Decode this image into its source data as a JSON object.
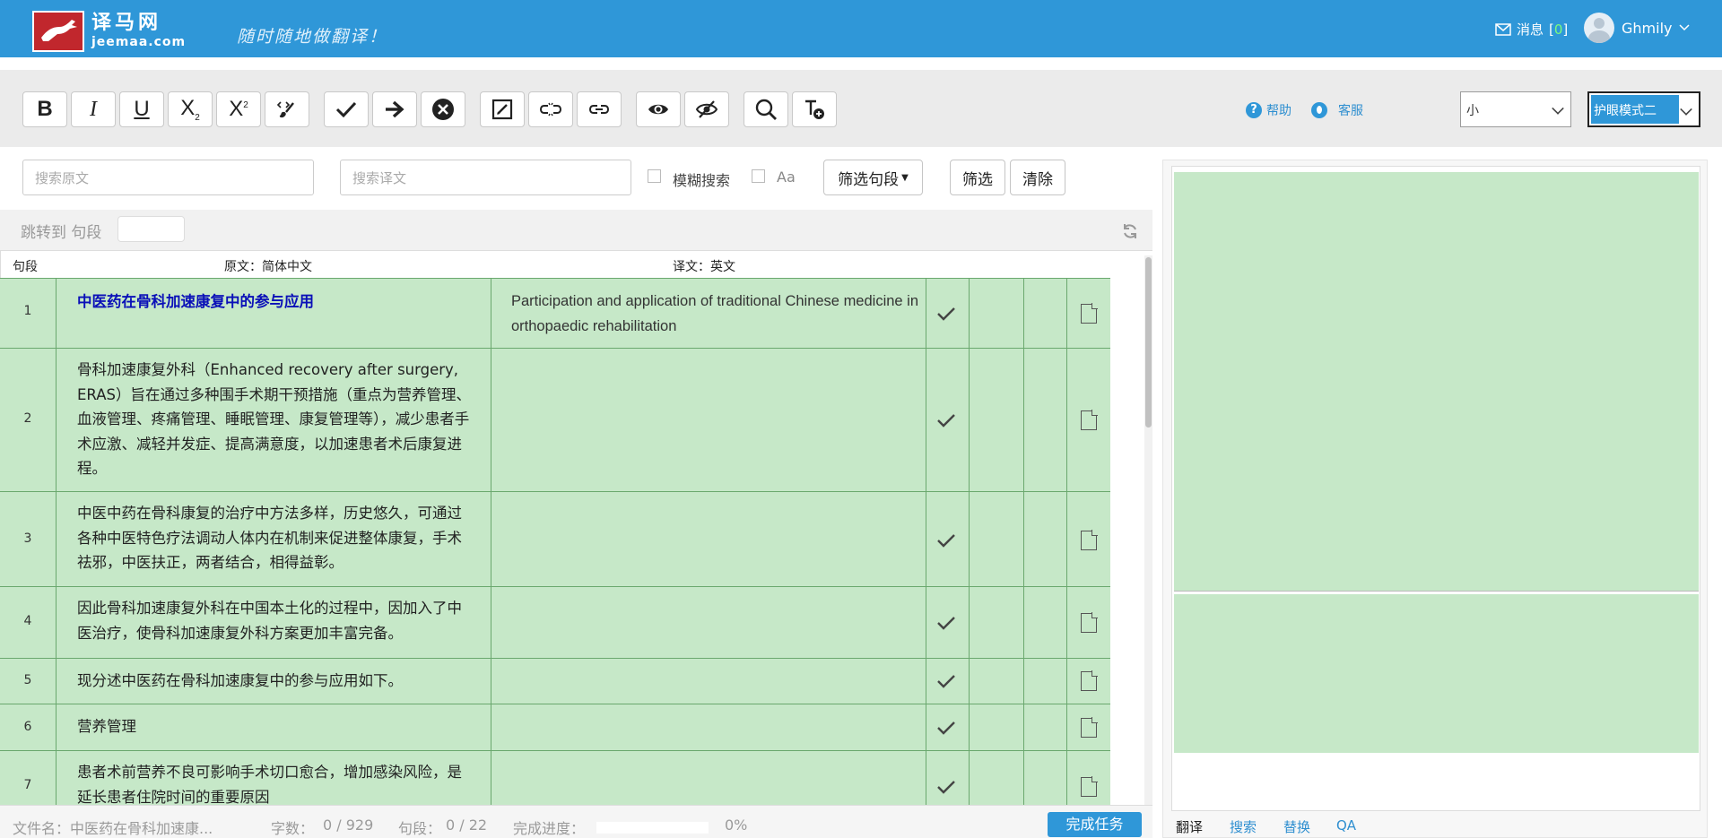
{
  "header": {
    "logo_cn": "译马网",
    "logo_en": "jeemaa.com",
    "slogan": "随时随地做翻译！",
    "messages_label": "消息",
    "messages_count": "0",
    "username": "Ghmily",
    "bg_color": "#2f97d8"
  },
  "toolbar": {
    "buttons": [
      {
        "name": "bold-button",
        "icon": "bold-icon",
        "glyph": "B"
      },
      {
        "name": "italic-button",
        "icon": "italic-icon",
        "glyph": "I"
      },
      {
        "name": "underline-button",
        "icon": "underline-icon",
        "glyph": "U"
      },
      {
        "name": "subscript-button",
        "icon": "subscript-icon",
        "glyph": "X₂"
      },
      {
        "name": "superscript-button",
        "icon": "superscript-icon",
        "glyph": "X²"
      },
      {
        "name": "clear-format-button",
        "icon": "brush-icon"
      },
      {
        "name": "confirm-button",
        "icon": "check-icon"
      },
      {
        "name": "next-button",
        "icon": "arrow-right-icon"
      },
      {
        "name": "cancel-button",
        "icon": "close-circle-icon"
      },
      {
        "name": "edit-button",
        "icon": "edit-box-icon"
      },
      {
        "name": "unlink-button",
        "icon": "unlink-icon"
      },
      {
        "name": "link-button",
        "icon": "link-icon"
      },
      {
        "name": "show-button",
        "icon": "eye-icon"
      },
      {
        "name": "hide-button",
        "icon": "eye-slash-icon"
      },
      {
        "name": "search-button",
        "icon": "search-icon"
      },
      {
        "name": "add-term-button",
        "icon": "text-add-icon"
      }
    ],
    "help_label": "帮助",
    "service_label": "客服",
    "font_size_value": "小",
    "mode_value": "护眼模式二"
  },
  "search": {
    "source_placeholder": "搜索原文",
    "target_placeholder": "搜索译文",
    "fuzzy_label": "模糊搜索",
    "case_label": "Aa",
    "filter_dropdown_label": "筛选句段",
    "filter_button": "筛选",
    "clear_button": "清除"
  },
  "jump": {
    "label": "跳转到 句段"
  },
  "columns": {
    "segment": "句段",
    "source": "原文：简体中文",
    "target": "译文：英文"
  },
  "segments": [
    {
      "num": "1",
      "source": "中医药在骨科加速康复中的参与应用",
      "target": "Participation and application of traditional Chinese medicine in orthopaedic rehabilitation"
    },
    {
      "num": "2",
      "source": "骨科加速康复外科（Enhanced recovery after surgery, ERAS）旨在通过多种围手术期干预措施（重点为营养管理、血液管理、疼痛管理、睡眠管理、康复管理等），减少患者手术应激、减轻并发症、提高满意度，以加速患者术后康复进程。",
      "target": ""
    },
    {
      "num": "3",
      "source": "中医中药在骨科康复的治疗中方法多样，历史悠久，可通过各种中医特色疗法调动人体内在机制来促进整体康复，手术祛邪，中医扶正，两者结合，相得益彰。",
      "target": ""
    },
    {
      "num": "4",
      "source": "因此骨科加速康复外科在中国本土化的过程中，因加入了中医治疗，使骨科加速康复外科方案更加丰富完备。",
      "target": ""
    },
    {
      "num": "5",
      "source": "现分述中医药在骨科加速康复中的参与应用如下。",
      "target": ""
    },
    {
      "num": "6",
      "source": "营养管理",
      "target": ""
    },
    {
      "num": "7",
      "source": "患者术前营养不良可影响手术切口愈合，增加感染风险，是延长患者住院时间的重要原因",
      "target": ""
    }
  ],
  "status": {
    "file_label": "文件名：中医药在骨科加速康...",
    "words_label": "字数：",
    "words_value": "0 / 929",
    "segments_label": "句段：",
    "segments_value": "0 / 22",
    "progress_label": "完成进度：",
    "progress_value": "0%",
    "progress_fraction": 0,
    "finish_button": "完成任务"
  },
  "right_panel": {
    "tabs": [
      "翻译",
      "搜索",
      "替换",
      "QA"
    ],
    "active_tab": "翻译"
  },
  "colors": {
    "row_bg": "#c6e8c8",
    "title_text": "#0a10b8",
    "accent": "#2f97d8"
  }
}
